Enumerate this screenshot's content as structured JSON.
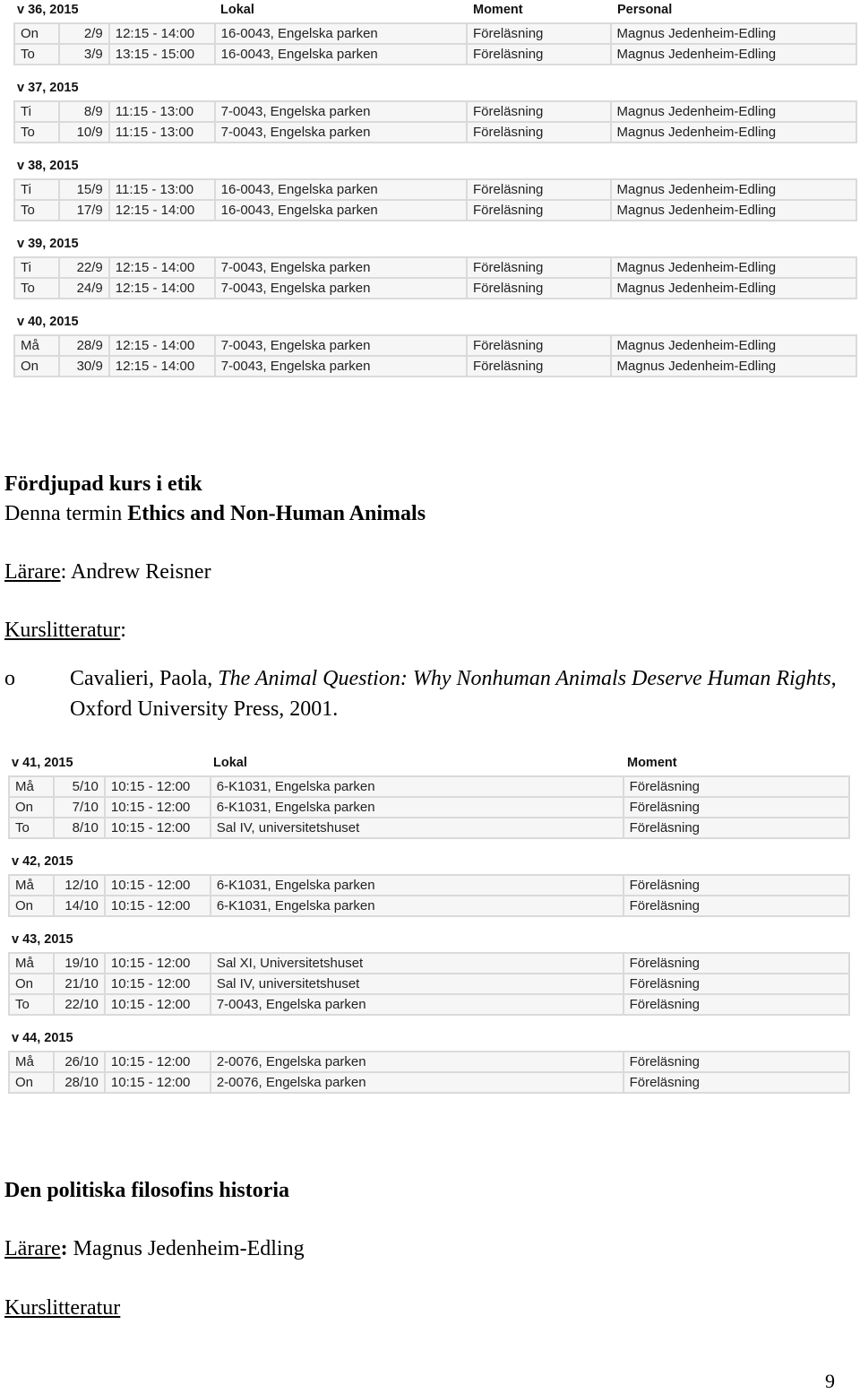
{
  "schedule1": {
    "headers": {
      "lokal": "Lokal",
      "moment": "Moment",
      "personal": "Personal"
    },
    "weeks": [
      {
        "label": "v 36, 2015",
        "rows": [
          {
            "day": "On",
            "date": "2/9",
            "time": "12:15 - 14:00",
            "room": "16-0043, Engelska parken",
            "moment": "Föreläsning",
            "staff": "Magnus Jedenheim-Edling"
          },
          {
            "day": "To",
            "date": "3/9",
            "time": "13:15 - 15:00",
            "room": "16-0043, Engelska parken",
            "moment": "Föreläsning",
            "staff": "Magnus Jedenheim-Edling"
          }
        ]
      },
      {
        "label": "v 37, 2015",
        "rows": [
          {
            "day": "Ti",
            "date": "8/9",
            "time": "11:15 - 13:00",
            "room": "7-0043, Engelska parken",
            "moment": "Föreläsning",
            "staff": "Magnus Jedenheim-Edling"
          },
          {
            "day": "To",
            "date": "10/9",
            "time": "11:15 - 13:00",
            "room": "7-0043, Engelska parken",
            "moment": "Föreläsning",
            "staff": "Magnus Jedenheim-Edling"
          }
        ]
      },
      {
        "label": "v 38, 2015",
        "rows": [
          {
            "day": "Ti",
            "date": "15/9",
            "time": "11:15 - 13:00",
            "room": "16-0043, Engelska parken",
            "moment": "Föreläsning",
            "staff": "Magnus Jedenheim-Edling"
          },
          {
            "day": "To",
            "date": "17/9",
            "time": "12:15 - 14:00",
            "room": "16-0043, Engelska parken",
            "moment": "Föreläsning",
            "staff": "Magnus Jedenheim-Edling"
          }
        ]
      },
      {
        "label": "v 39, 2015",
        "rows": [
          {
            "day": "Ti",
            "date": "22/9",
            "time": "12:15 - 14:00",
            "room": "7-0043, Engelska parken",
            "moment": "Föreläsning",
            "staff": "Magnus Jedenheim-Edling"
          },
          {
            "day": "To",
            "date": "24/9",
            "time": "12:15 - 14:00",
            "room": "7-0043, Engelska parken",
            "moment": "Föreläsning",
            "staff": "Magnus Jedenheim-Edling"
          }
        ]
      },
      {
        "label": "v 40, 2015",
        "rows": [
          {
            "day": "Må",
            "date": "28/9",
            "time": "12:15 - 14:00",
            "room": "7-0043, Engelska parken",
            "moment": "Föreläsning",
            "staff": "Magnus Jedenheim-Edling"
          },
          {
            "day": "On",
            "date": "30/9",
            "time": "12:15 - 14:00",
            "room": "7-0043, Engelska parken",
            "moment": "Föreläsning",
            "staff": "Magnus Jedenheim-Edling"
          }
        ]
      }
    ]
  },
  "course1": {
    "title": "Fördjupad kurs i etik",
    "term_prefix": "Denna termin ",
    "term_title": "Ethics and Non-Human Animals",
    "teacher_label": "Lärare",
    "teacher_sep": ": ",
    "teacher_name": "Andrew Reisner",
    "literature_label": "Kurslitteratur",
    "literature_colon": ":",
    "literature": [
      {
        "bullet": "o",
        "author": "Cavalieri, Paola, ",
        "title": "The Animal Question: Why Nonhuman Animals Deserve Human Rights",
        "rest": ", Oxford University Press, 2001."
      }
    ]
  },
  "schedule2": {
    "headers": {
      "lokal": "Lokal",
      "moment": "Moment"
    },
    "weeks": [
      {
        "label": "v 41, 2015",
        "rows": [
          {
            "day": "Må",
            "date": "5/10",
            "time": "10:15 - 12:00",
            "room": "6-K1031, Engelska parken",
            "moment": "Föreläsning"
          },
          {
            "day": "On",
            "date": "7/10",
            "time": "10:15 - 12:00",
            "room": "6-K1031, Engelska parken",
            "moment": "Föreläsning"
          },
          {
            "day": "To",
            "date": "8/10",
            "time": "10:15 - 12:00",
            "room": "Sal IV, universitetshuset",
            "moment": "Föreläsning"
          }
        ]
      },
      {
        "label": "v 42, 2015",
        "rows": [
          {
            "day": "Må",
            "date": "12/10",
            "time": "10:15 - 12:00",
            "room": "6-K1031, Engelska parken",
            "moment": "Föreläsning"
          },
          {
            "day": "On",
            "date": "14/10",
            "time": "10:15 - 12:00",
            "room": "6-K1031, Engelska parken",
            "moment": "Föreläsning"
          }
        ]
      },
      {
        "label": "v 43, 2015",
        "rows": [
          {
            "day": "Må",
            "date": "19/10",
            "time": "10:15 - 12:00",
            "room": "Sal XI, Universitetshuset",
            "moment": "Föreläsning"
          },
          {
            "day": "On",
            "date": "21/10",
            "time": "10:15 - 12:00",
            "room": "Sal IV, universitetshuset",
            "moment": "Föreläsning"
          },
          {
            "day": "To",
            "date": "22/10",
            "time": "10:15 - 12:00",
            "room": "7-0043, Engelska parken",
            "moment": "Föreläsning"
          }
        ]
      },
      {
        "label": "v 44, 2015",
        "rows": [
          {
            "day": "Må",
            "date": "26/10",
            "time": "10:15 - 12:00",
            "room": "2-0076, Engelska parken",
            "moment": "Föreläsning"
          },
          {
            "day": "On",
            "date": "28/10",
            "time": "10:15 - 12:00",
            "room": "2-0076, Engelska parken",
            "moment": "Föreläsning"
          }
        ]
      }
    ]
  },
  "course2": {
    "title": "Den politiska filosofins historia",
    "teacher_label": "Lärare",
    "teacher_sep": ": ",
    "teacher_name": "Magnus Jedenheim-Edling",
    "literature_label": "Kurslitteratur"
  },
  "page_number": "9"
}
